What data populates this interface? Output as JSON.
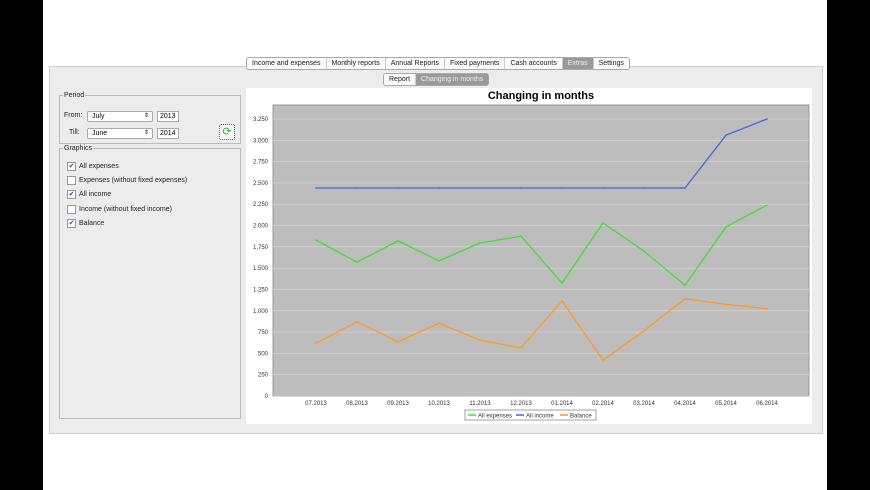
{
  "main_tabs": [
    {
      "label": "Income and expenses"
    },
    {
      "label": "Monthly reports"
    },
    {
      "label": "Annual Reports"
    },
    {
      "label": "Fixed payments"
    },
    {
      "label": "Cash accounts"
    },
    {
      "label": "Extras",
      "selected": true
    },
    {
      "label": "Settings"
    }
  ],
  "sub_tabs": [
    {
      "label": "Report"
    },
    {
      "label": "Changing in months",
      "selected": true
    }
  ],
  "period": {
    "legend": "Period",
    "from_label": "From:",
    "from_month": "July",
    "from_year": "2013",
    "till_label": "Till:",
    "till_month": "June",
    "till_year": "2014",
    "refresh_icon": "refresh-icon"
  },
  "graphics": {
    "legend": "Graphics",
    "items": [
      {
        "label": "All expenses",
        "checked": true
      },
      {
        "label": "Expenses (without fixed expenses)",
        "checked": false
      },
      {
        "label": "All income",
        "checked": true
      },
      {
        "label": "Income (without fixed income)",
        "checked": false
      },
      {
        "label": "Balance",
        "checked": true
      }
    ]
  },
  "chart_data": {
    "type": "line",
    "title": "Changing in months",
    "xlabel": "",
    "ylabel": "",
    "ylim": [
      0,
      3250
    ],
    "yticks": [
      "0",
      "250",
      "500",
      "750",
      "1.000",
      "1.250",
      "1.500",
      "1.750",
      "2.000",
      "2.250",
      "2.500",
      "2.750",
      "3.000",
      "3.250"
    ],
    "categories": [
      "07.2013",
      "08.2013",
      "09.2013",
      "10.2013",
      "11.2013",
      "12.2013",
      "01.2014",
      "02.2014",
      "03.2014",
      "04.2014",
      "05.2014",
      "06.2014"
    ],
    "series": [
      {
        "name": "All expenses",
        "color": "#44dd33",
        "values": [
          1830,
          1570,
          1820,
          1585,
          1795,
          1875,
          1325,
          2030,
          1700,
          1300,
          1985,
          2240
        ]
      },
      {
        "name": "All income",
        "color": "#4466dd",
        "values": [
          2440,
          2440,
          2440,
          2440,
          2440,
          2440,
          2440,
          2440,
          2440,
          2440,
          3060,
          3250
        ]
      },
      {
        "name": "Balance",
        "color": "#ff9922",
        "values": [
          620,
          870,
          635,
          855,
          655,
          565,
          1115,
          420,
          765,
          1140,
          1075,
          1025
        ]
      }
    ],
    "legend": "bottom",
    "grid": true
  }
}
